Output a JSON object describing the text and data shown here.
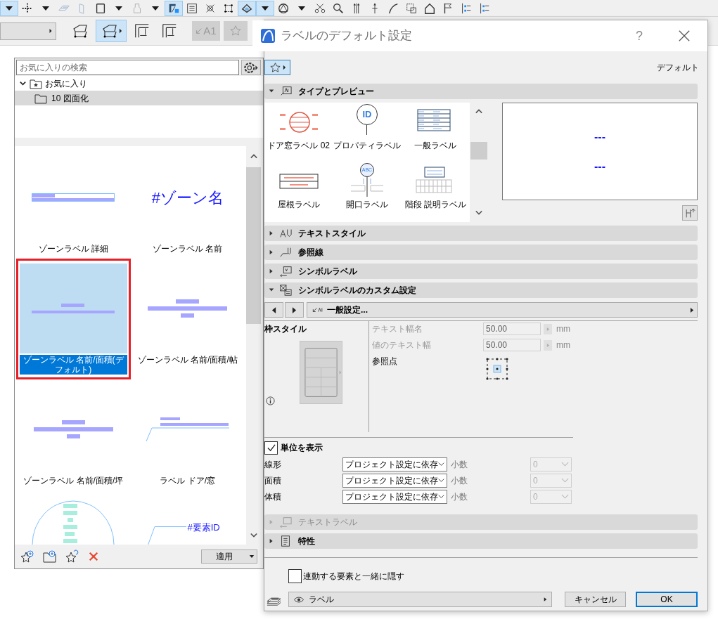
{
  "toolbar": {
    "row_1": [
      {
        "kind": "caret",
        "selected": true
      },
      {
        "kind": "grid",
        "selected": false
      },
      {
        "kind": "caret",
        "selected": false
      },
      {
        "kind": "slab",
        "selected": false
      },
      {
        "kind": "door",
        "selected": false
      },
      {
        "kind": "box",
        "selected": false
      },
      {
        "kind": "caret",
        "selected": false
      },
      {
        "kind": "lamp",
        "selected": false
      },
      {
        "kind": "caret",
        "selected": false
      },
      {
        "kind": "select",
        "selected": true
      },
      {
        "kind": "numbers",
        "selected": false
      },
      {
        "kind": "cross",
        "selected": false
      },
      {
        "kind": "nodes",
        "selected": false
      },
      {
        "kind": "wand",
        "selected": true
      },
      {
        "kind": "caret",
        "selected": true
      },
      {
        "kind": "triangle",
        "selected": false
      },
      {
        "kind": "caret",
        "selected": false
      },
      {
        "kind": "scissors",
        "selected": false
      },
      {
        "kind": "magnify",
        "selected": false
      },
      {
        "kind": "arrows",
        "selected": false
      },
      {
        "kind": "pin",
        "selected": false
      },
      {
        "kind": "pen",
        "selected": false
      },
      {
        "kind": "frame",
        "selected": false
      },
      {
        "kind": "house",
        "selected": false
      },
      {
        "kind": "flag",
        "selected": false
      },
      {
        "kind": "list",
        "selected": false
      },
      {
        "kind": "list",
        "selected": false
      }
    ],
    "row_2": [
      {
        "kind": "dropdown_field"
      },
      {
        "kind": "box3d",
        "selected": false
      },
      {
        "kind": "box3d_caret",
        "selected": true
      },
      {
        "kind": "dimension",
        "selected": false
      },
      {
        "kind": "dimension",
        "selected": false
      },
      {
        "kind": "label_button",
        "text": "A1",
        "disabled": true
      },
      {
        "kind": "star_button",
        "disabled": true
      }
    ]
  },
  "palette": {
    "search": {
      "placeholder": "お気に入りの検索"
    },
    "tree": [
      {
        "label": "お気に入り",
        "expanded": true,
        "selected": false,
        "children": [
          {
            "label": "10 図面化",
            "selected": true
          }
        ]
      }
    ],
    "items": [
      {
        "label": "ゾーンラベル 詳細",
        "kind": "detail",
        "selected": false
      },
      {
        "label": "ゾーンラベル 名前",
        "kind": "name",
        "preview_text": "#ゾーン名",
        "selected": false
      },
      {
        "label": "ゾーンラベル 名前/面積(デフォルト)",
        "kind": "center",
        "selected": true
      },
      {
        "label": "ゾーンラベル 名前/面積/帖",
        "kind": "stack",
        "selected": false
      },
      {
        "label": "ゾーンラベル 名前/面積/坪",
        "kind": "stack",
        "selected": false
      },
      {
        "label": "ラベル ドア/窓",
        "kind": "leader",
        "selected": false
      },
      {
        "kind": "oval",
        "selected": false
      },
      {
        "kind": "id_leader",
        "preview_text": "#要素ID",
        "selected": false
      }
    ],
    "apply_button": "適用"
  },
  "dialog": {
    "title": "ラベルのデフォルト設定",
    "help": "?",
    "preset": "デフォルト",
    "sections": [
      {
        "title": "タイプとプレビュー",
        "kind": "types",
        "expanded": true,
        "disabled": false,
        "label_types": [
          {
            "label": "ドア窓ラベル 02",
            "kind": "door_window"
          },
          {
            "label": "プロパティラベル",
            "kind": "property",
            "icon_text": "ID"
          },
          {
            "label": "一般ラベル",
            "kind": "general"
          },
          {
            "label": "屋根ラベル",
            "kind": "roof"
          },
          {
            "label": "開口ラベル",
            "kind": "opening",
            "icon_text": "ABC"
          },
          {
            "label": "階段 説明ラベル",
            "kind": "stair"
          }
        ],
        "preview": [
          "---",
          "---"
        ]
      },
      {
        "title": "テキストスタイル",
        "kind": "text_style",
        "expanded": false,
        "disabled": false
      },
      {
        "title": "参照線",
        "kind": "leader",
        "expanded": false,
        "disabled": false
      },
      {
        "title": "シンボルラベル",
        "kind": "symbol",
        "expanded": false,
        "disabled": false
      },
      {
        "title": "シンボルラベルのカスタム設定",
        "kind": "custom",
        "expanded": true,
        "disabled": false,
        "page": "一般設定...",
        "frame_style_title": "枠スタイル",
        "fields": [
          {
            "label": "テキスト幅名",
            "value": "50.00",
            "unit": "mm",
            "disabled": true
          },
          {
            "label": "値のテキスト幅",
            "value": "50.00",
            "unit": "mm",
            "disabled": true
          }
        ],
        "reference_point_label": "参照点",
        "show_units": {
          "label": "単位を表示",
          "checked": true
        },
        "unit_rows": [
          {
            "label": "線形",
            "value": "プロジェクト設定に依存",
            "decimals_label": "小数",
            "decimals": "0",
            "decimals_disabled": true
          },
          {
            "label": "面積",
            "value": "プロジェクト設定に依存",
            "decimals_label": "小数",
            "decimals": "0",
            "decimals_disabled": true
          },
          {
            "label": "体積",
            "value": "プロジェクト設定に依存",
            "decimals_label": "小数",
            "decimals": "0",
            "decimals_disabled": true
          }
        ]
      },
      {
        "title": "テキストラベル",
        "kind": "text_label",
        "expanded": false,
        "disabled": true
      },
      {
        "title": "特性",
        "kind": "properties",
        "expanded": false,
        "disabled": false
      }
    ],
    "footer": {
      "hide_with_element": {
        "label": "連動する要素と一緒に隠す",
        "checked": false
      },
      "layer": "ラベル",
      "cancel": "キャンセル",
      "ok": "OK"
    }
  }
}
